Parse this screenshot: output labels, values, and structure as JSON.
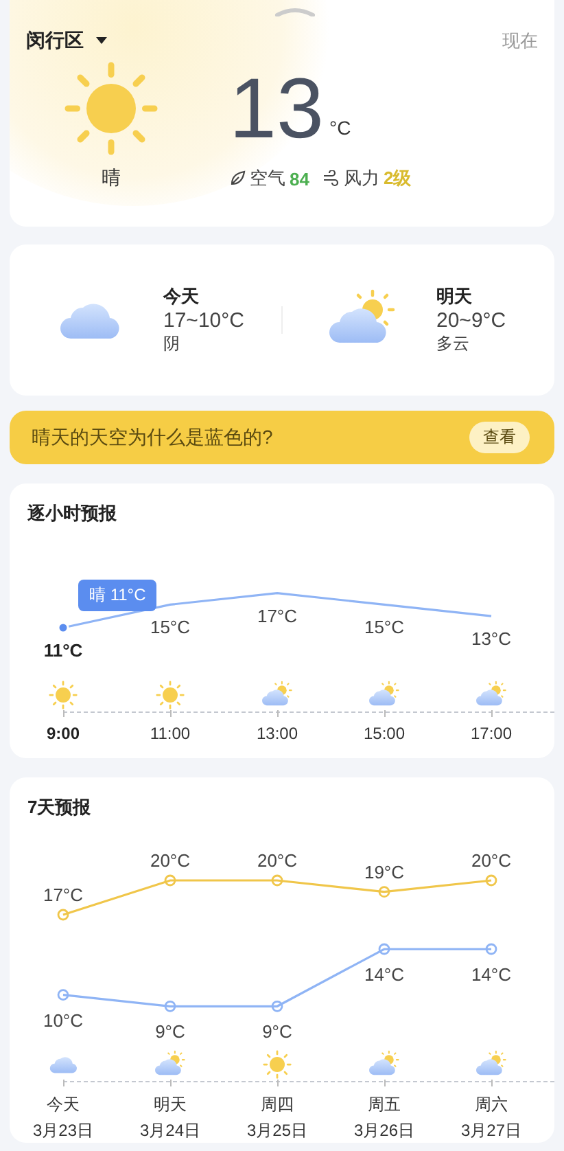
{
  "current": {
    "location": "闵行区",
    "time_label": "现在",
    "temperature": "13",
    "unit": "°C",
    "condition": "晴",
    "kind": "sunny",
    "metrics": [
      {
        "kind": "air",
        "label": "空气",
        "value": "84",
        "color": "#4caf50"
      },
      {
        "kind": "wind",
        "label": "风力",
        "value": "2级",
        "color": "#d9bb2e"
      }
    ]
  },
  "days": [
    {
      "label": "今天",
      "range": "17~10°C",
      "condition": "阴",
      "kind": "cloudy"
    },
    {
      "label": "明天",
      "range": "20~9°C",
      "condition": "多云",
      "kind": "partly_cloudy"
    }
  ],
  "banner": {
    "text": "晴天的天空为什么是蓝色的?",
    "button": "查看"
  },
  "hourly": {
    "title": "逐小时预报",
    "tooltip": "晴 11°C",
    "hours": [
      {
        "kind": "sunny",
        "selected": true
      },
      {
        "kind": "sunny",
        "selected": false
      },
      {
        "kind": "partly_cloudy",
        "selected": false
      },
      {
        "kind": "partly_cloudy",
        "selected": false
      },
      {
        "kind": "partly_cloudy",
        "selected": false
      }
    ],
    "chart_data": {
      "type": "line",
      "categories": [
        "9:00",
        "11:00",
        "13:00",
        "15:00",
        "17:00"
      ],
      "series": [
        {
          "color": "#8fb4f5",
          "values": [
            11,
            15,
            17,
            15,
            13
          ],
          "value_labels": [
            "11°C",
            "15°C",
            "17°C",
            "15°C",
            "13°C"
          ]
        }
      ]
    }
  },
  "weekly": {
    "title": "7天预报",
    "days": [
      {
        "date": "3月23日",
        "kind": "cloudy"
      },
      {
        "date": "3月24日",
        "kind": "partly_cloudy"
      },
      {
        "date": "3月25日",
        "kind": "sunny"
      },
      {
        "date": "3月26日",
        "kind": "partly_cloudy"
      },
      {
        "date": "3月27日",
        "kind": "partly_cloudy"
      }
    ],
    "chart_data": {
      "type": "line",
      "categories": [
        "今天",
        "明天",
        "周四",
        "周五",
        "周六"
      ],
      "series": [
        {
          "color": "#f0c64a",
          "marker": "o",
          "values": [
            17,
            20,
            20,
            19,
            20
          ],
          "value_labels": [
            "17°C",
            "20°C",
            "20°C",
            "19°C",
            "20°C"
          ]
        },
        {
          "color": "#8fb4f5",
          "marker": "o",
          "values": [
            10,
            9,
            9,
            14,
            14
          ],
          "value_labels": [
            "10°C",
            "9°C",
            "9°C",
            "14°C",
            "14°C"
          ]
        }
      ]
    }
  }
}
